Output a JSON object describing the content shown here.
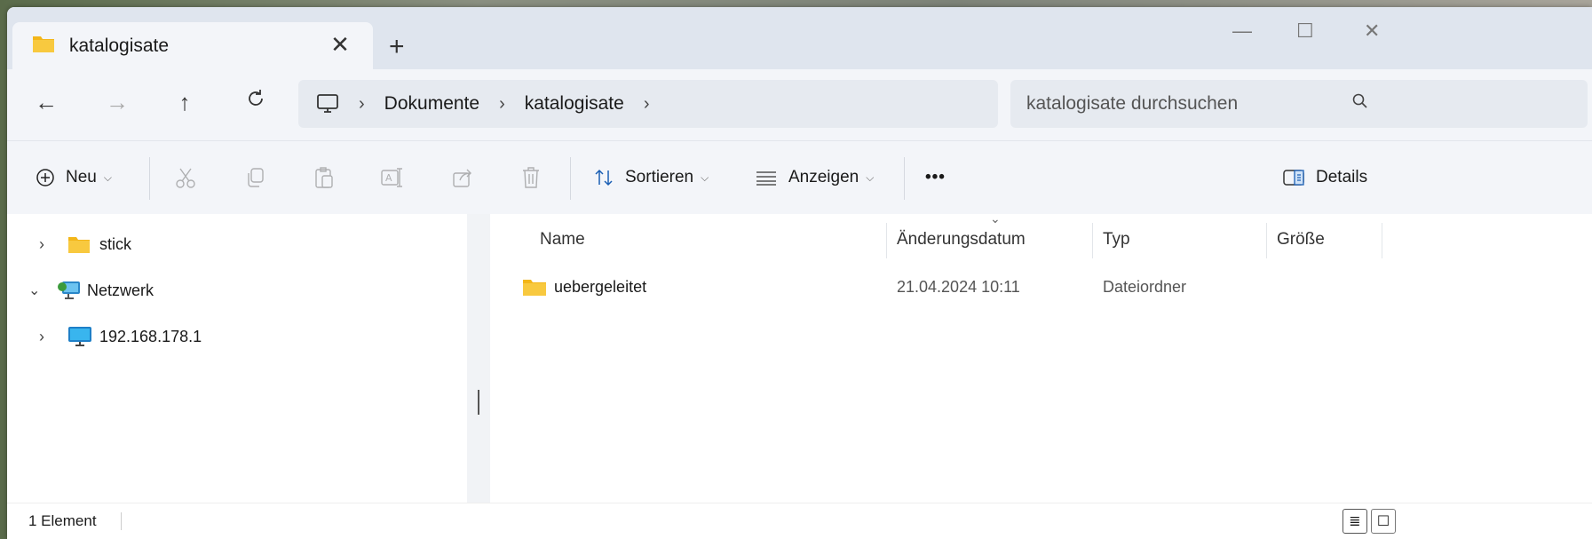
{
  "tab": {
    "title": "katalogisate",
    "close": "✕",
    "new_tab": "+"
  },
  "window_controls": {
    "minimize": "—",
    "maximize": "☐",
    "close": "✕"
  },
  "nav": {
    "back": "←",
    "forward": "→",
    "up": "↑",
    "breadcrumb": [
      "Dokumente",
      "katalogisate"
    ],
    "search_placeholder": "katalogisate durchsuchen"
  },
  "toolbar": {
    "new_label": "Neu",
    "sort_label": "Sortieren",
    "view_label": "Anzeigen",
    "more_label": "•••",
    "details_label": "Details"
  },
  "tree": [
    {
      "label": "stick",
      "expanded": false
    },
    {
      "label": "Netzwerk",
      "expanded": true
    },
    {
      "label": "192.168.178.1",
      "expanded": false
    }
  ],
  "columns": {
    "name": "Name",
    "date": "Änderungsdatum",
    "type": "Typ",
    "size": "Größe"
  },
  "files": [
    {
      "name": "uebergeleitet",
      "date": "21.04.2024 10:11",
      "type": "Dateiordner",
      "size": ""
    }
  ],
  "status": {
    "count": "1 Element"
  },
  "colors": {
    "folder": "#f3b619",
    "accent": "#0067c0"
  }
}
